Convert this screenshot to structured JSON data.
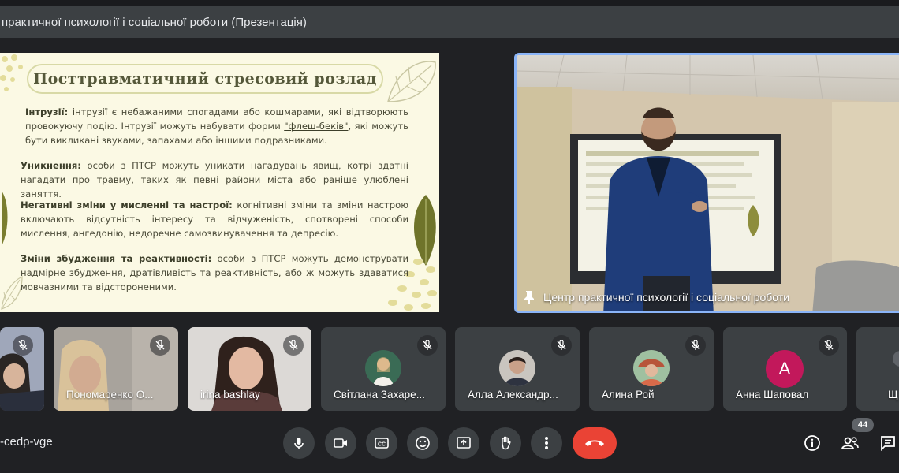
{
  "window": {
    "title": "практичної психології і соціальної роботи (Презентація)"
  },
  "slide": {
    "title": "Посттравматичний стресовий розлад",
    "paragraphs": [
      {
        "heading": "Інтрузії:",
        "pre": " інтрузії є небажаними спогадами або кошмарами, які відтворюють провокуючу подію. Інтрузії можуть набувати форми ",
        "link": "\"флеш-беків\"",
        "post": ", які можуть бути викликані звуками, запахами або іншими подразниками."
      },
      {
        "heading": "Уникнення:",
        "text": " особи з ПТСР можуть уникати нагадувань явищ, котрі здатні нагадати про травму, таких як певні райони міста або раніше улюблені заняття."
      },
      {
        "heading": "Негативні зміни у мисленні та настрої:",
        "text": " когнітивні зміни та зміни настрою включають відсутність інтересу та відчуженість, спотворені способи мислення, ангедонію, недоречне самозвинувачення та депресію."
      },
      {
        "heading": "Зміни збудження та реактивності:",
        "text": " особи з ПТСР можуть демонструвати надмірне збудження, дратівливість та реактивність, або ж можуть здаватися мовчазними та відстороненими."
      }
    ]
  },
  "main_video": {
    "label": "Центр практичної психології і соціальної роботи",
    "pin_icon": "pin-icon"
  },
  "participants": [
    {
      "name": "",
      "muted": true
    },
    {
      "name": "Пономаренко О...",
      "muted": true
    },
    {
      "name": "irina bashlay",
      "muted": true
    },
    {
      "name": "Світлана Захаре...",
      "muted": true
    },
    {
      "name": "Алла Александр...",
      "muted": true
    },
    {
      "name": "Алина Рой",
      "muted": true
    },
    {
      "name": "Анна Шаповал",
      "muted": true,
      "initial": "А",
      "avatar_color": "#c2185b"
    },
    {
      "name": "Щ",
      "muted": true
    }
  ],
  "meeting": {
    "code": "-cedp-vge",
    "participant_count": "44"
  },
  "controls": {
    "icons": [
      "microphone-icon",
      "camera-icon",
      "captions-icon",
      "emoji-icon",
      "present-icon",
      "raise-hand-icon",
      "more-options-icon",
      "end-call-icon"
    ],
    "right_icons": [
      "info-icon",
      "people-icon",
      "chat-icon"
    ]
  },
  "colors": {
    "background": "#202124",
    "tile": "#3c4043",
    "active_border": "#8ab4f8",
    "end_call": "#ea4335"
  }
}
